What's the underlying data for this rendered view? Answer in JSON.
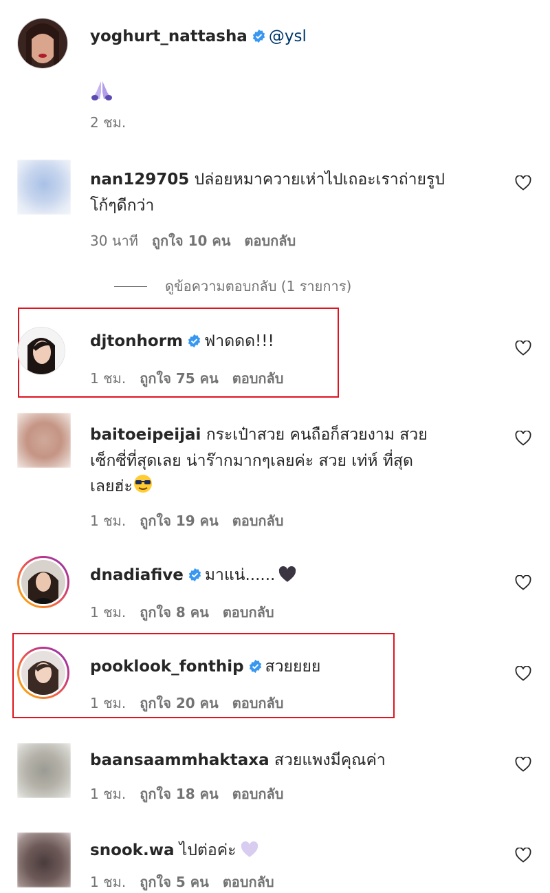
{
  "comments": [
    {
      "username": "yoghurt_nattasha",
      "verified": true,
      "text": "",
      "mention": "@ysl",
      "emoji_line": "praying-hands",
      "time": "2 ชม.",
      "likes": "",
      "reply": ""
    },
    {
      "username": "nan129705",
      "verified": false,
      "text": "ปล่อยหมาควายเห่าไปเถอะเราถ่ายรูป",
      "text2": "โก้ๆดีกว่า",
      "time": "30 นาที",
      "likes": "ถูกใจ 10 คน",
      "reply": "ตอบกลับ"
    },
    {
      "username": "djtonhorm",
      "verified": true,
      "text": "ฟาดดด!!!",
      "time": "1 ชม.",
      "likes": "ถูกใจ 75 คน",
      "reply": "ตอบกลับ"
    },
    {
      "username": "baitoeipeijai",
      "verified": false,
      "text": "กระเป๋าสวย คนถือก็สวยงาม สวย",
      "text2": "เซ็กซี่ที่สุดเลย น่าร๊ากมากๆเลยค่ะ สวย เท่ห์ ที่สุด",
      "text3": "เลยฮ่ะ",
      "time": "1 ชม.",
      "likes": "ถูกใจ 19 คน",
      "reply": "ตอบกลับ"
    },
    {
      "username": "dnadiafive",
      "verified": true,
      "text": "มาแน่......",
      "time": "1 ชม.",
      "likes": "ถูกใจ 8 คน",
      "reply": "ตอบกลับ"
    },
    {
      "username": "pooklook_fonthip",
      "verified": true,
      "text": "สวยยยย",
      "time": "1 ชม.",
      "likes": "ถูกใจ 20 คน",
      "reply": "ตอบกลับ"
    },
    {
      "username": "baansaammhaktaxa",
      "verified": false,
      "text": "สวยแพงมีคุณค่า",
      "time": "1 ชม.",
      "likes": "ถูกใจ 18 คน",
      "reply": "ตอบกลับ"
    },
    {
      "username": "snook.wa",
      "verified": false,
      "text": "ไปต่อค่ะ",
      "time": "1 ชม.",
      "likes": "ถูกใจ 5 คน",
      "reply": "ตอบกลับ"
    }
  ],
  "view_replies": "ดูข้อความตอบกลับ (1 รายการ)",
  "colors": {
    "verified": "#3897f0",
    "highlight": "#e0141e",
    "secondary_text": "#737373"
  }
}
